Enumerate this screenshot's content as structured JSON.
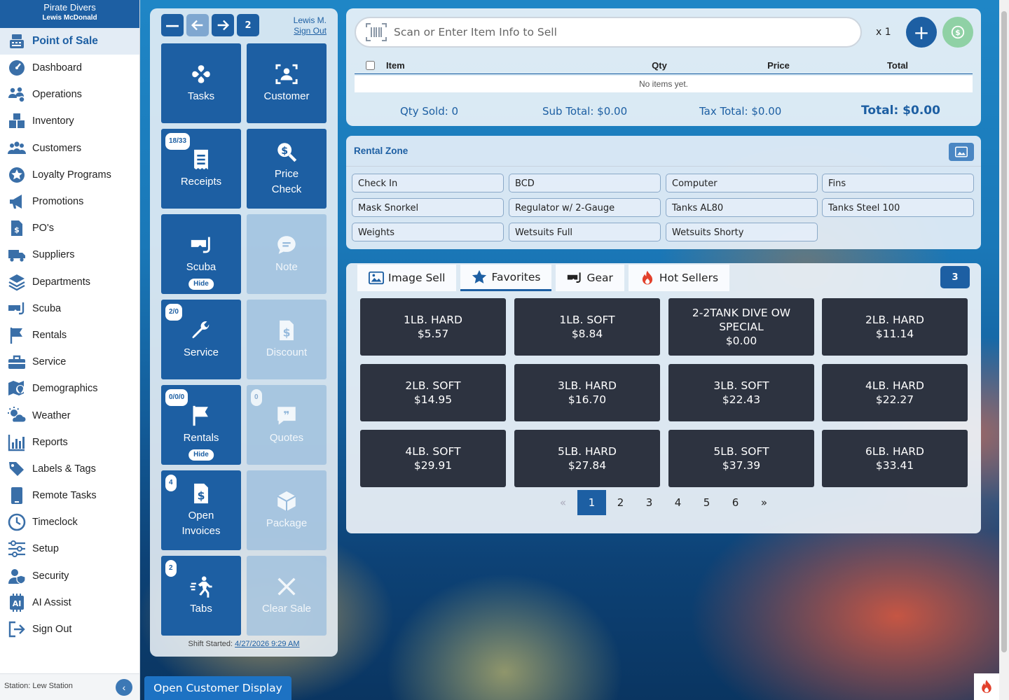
{
  "brand": {
    "name": "Pirate Divers",
    "user": "Lewis McDonald"
  },
  "sidebar": {
    "items": [
      {
        "label": "Point of Sale",
        "icon": "register-icon",
        "active": true
      },
      {
        "label": "Dashboard",
        "icon": "dashboard-icon"
      },
      {
        "label": "Operations",
        "icon": "operations-icon"
      },
      {
        "label": "Inventory",
        "icon": "inventory-icon"
      },
      {
        "label": "Customers",
        "icon": "customers-icon"
      },
      {
        "label": "Loyalty Programs",
        "icon": "loyalty-icon"
      },
      {
        "label": "Promotions",
        "icon": "megaphone-icon"
      },
      {
        "label": "PO's",
        "icon": "purchase-order-icon"
      },
      {
        "label": "Suppliers",
        "icon": "truck-icon"
      },
      {
        "label": "Departments",
        "icon": "layers-icon"
      },
      {
        "label": "Scuba",
        "icon": "mask-icon"
      },
      {
        "label": "Rentals",
        "icon": "flag-icon"
      },
      {
        "label": "Service",
        "icon": "toolbox-icon"
      },
      {
        "label": "Demographics",
        "icon": "map-pin-icon"
      },
      {
        "label": "Weather",
        "icon": "weather-icon"
      },
      {
        "label": "Reports",
        "icon": "chart-icon"
      },
      {
        "label": "Labels & Tags",
        "icon": "tag-icon"
      },
      {
        "label": "Remote Tasks",
        "icon": "tablet-icon"
      },
      {
        "label": "Timeclock",
        "icon": "clock-icon"
      },
      {
        "label": "Setup",
        "icon": "sliders-icon"
      },
      {
        "label": "Security",
        "icon": "security-icon"
      },
      {
        "label": "AI Assist",
        "icon": "ai-icon"
      },
      {
        "label": "Sign Out",
        "icon": "sign-out-icon"
      }
    ],
    "station": "Station: Lew Station"
  },
  "panel": {
    "counter": "2",
    "user_short": "Lewis M.",
    "sign_out": "Sign Out",
    "tiles": {
      "tasks": {
        "label": "Tasks"
      },
      "customer": {
        "label": "Customer"
      },
      "receipts": {
        "label": "Receipts",
        "badge": "18/33"
      },
      "price_check": {
        "label1": "Price",
        "label2": "Check"
      },
      "scuba": {
        "label": "Scuba",
        "pill": "Hide"
      },
      "note": {
        "label": "Note"
      },
      "service": {
        "label": "Service",
        "badge": "2/0"
      },
      "discount": {
        "label": "Discount"
      },
      "rentals": {
        "label": "Rentals",
        "badge": "0/0/0",
        "pill": "Hide"
      },
      "quotes": {
        "label": "Quotes",
        "badge": "0"
      },
      "open_invoices": {
        "label1": "Open",
        "label2": "Invoices",
        "badge": "4"
      },
      "package": {
        "label": "Package"
      },
      "tabs": {
        "label": "Tabs",
        "badge": "2"
      },
      "clear_sale": {
        "label": "Clear Sale"
      }
    },
    "shift_label": "Shift Started:",
    "shift_time": "4/27/2026 9:29 AM"
  },
  "cart": {
    "scan_placeholder": "Scan or Enter Item Info to Sell",
    "multiplier": "x 1",
    "columns": {
      "item": "Item",
      "qty": "Qty",
      "price": "Price",
      "total": "Total"
    },
    "empty_text": "No items yet.",
    "qty_sold": "Qty Sold:  0",
    "sub_total": "Sub Total:  $0.00",
    "tax_total": "Tax Total:  $0.00",
    "total": "Total:  $0.00"
  },
  "rental_zone": {
    "title": "Rental Zone",
    "buttons": [
      "Check In",
      "BCD",
      "Computer",
      "Fins",
      "Mask Snorkel",
      "Regulator w/ 2-Gauge",
      "Tanks AL80",
      "Tanks Steel 100",
      "Weights",
      "Wetsuits Full",
      "Wetsuits Shorty"
    ]
  },
  "products": {
    "tabs": [
      {
        "label": "Image Sell",
        "icon": "image-icon"
      },
      {
        "label": "Favorites",
        "icon": "star-icon",
        "active": true
      },
      {
        "label": "Gear",
        "icon": "mask-icon"
      },
      {
        "label": "Hot Sellers",
        "icon": "flame-icon"
      }
    ],
    "page_count_badge": "3",
    "items": [
      {
        "name": "1LB. HARD",
        "price": "$5.57"
      },
      {
        "name": "1LB. SOFT",
        "price": "$8.84"
      },
      {
        "name": "2-2TANK DIVE OW SPECIAL",
        "price": "$0.00"
      },
      {
        "name": "2LB. HARD",
        "price": "$11.14"
      },
      {
        "name": "2LB. SOFT",
        "price": "$14.95"
      },
      {
        "name": "3LB. HARD",
        "price": "$16.70"
      },
      {
        "name": "3LB. SOFT",
        "price": "$22.43"
      },
      {
        "name": "4LB. HARD",
        "price": "$22.27"
      },
      {
        "name": "4LB. SOFT",
        "price": "$29.91"
      },
      {
        "name": "5LB. HARD",
        "price": "$27.84"
      },
      {
        "name": "5LB. SOFT",
        "price": "$37.39"
      },
      {
        "name": "6LB. HARD",
        "price": "$33.41"
      }
    ],
    "pager": {
      "prev": "«",
      "pages": [
        "1",
        "2",
        "3",
        "4",
        "5",
        "6"
      ],
      "next": "»",
      "current": "1"
    }
  },
  "footer": {
    "customer_display": "Open Customer Display"
  },
  "colors": {
    "primary": "#1d5fa3",
    "tile_disabled": "#96bad c",
    "product_tile": "#2d3340",
    "pay_button": "#8fd1a5"
  }
}
